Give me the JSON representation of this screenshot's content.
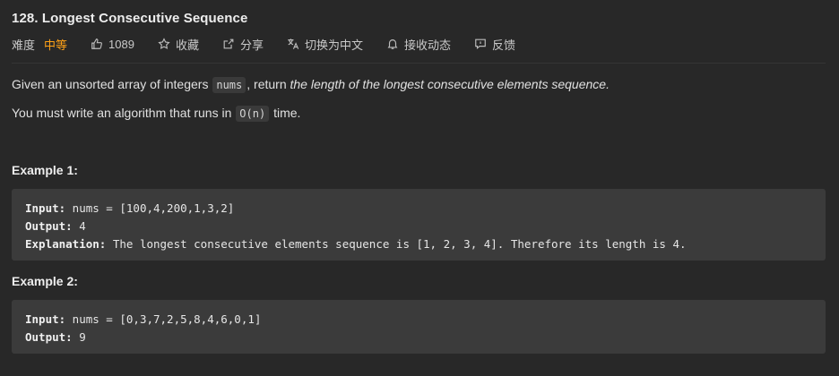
{
  "problem": {
    "title": "128. Longest Consecutive Sequence"
  },
  "meta": {
    "difficulty_label": "难度",
    "difficulty_value": "中等",
    "likes": "1089",
    "favorite": "收藏",
    "share": "分享",
    "switch_lang": "切换为中文",
    "notify": "接收动态",
    "feedback": "反馈",
    "colors": {
      "difficulty": "#ffa116"
    },
    "icons": [
      "thumbs-up-icon",
      "star-icon",
      "share-icon",
      "translate-icon",
      "bell-icon",
      "feedback-icon"
    ]
  },
  "description": {
    "p1_before": "Given an unsorted array of integers ",
    "p1_code": "nums",
    "p1_mid": ", return ",
    "p1_em": "the length of the longest consecutive elements sequence.",
    "p2_before": "You must write an algorithm that runs in ",
    "p2_code": "O(n)",
    "p2_after": " time."
  },
  "examples": [
    {
      "heading": "Example 1:",
      "input_label": "Input:",
      "input_value": " nums = [100,4,200,1,3,2]",
      "output_label": "Output:",
      "output_value": " 4",
      "explanation_label": "Explanation:",
      "explanation_value": " The longest consecutive elements sequence is [1, 2, 3, 4]. Therefore its length is 4."
    },
    {
      "heading": "Example 2:",
      "input_label": "Input:",
      "input_value": " nums = [0,3,7,2,5,8,4,6,0,1]",
      "output_label": "Output:",
      "output_value": " 9"
    }
  ]
}
